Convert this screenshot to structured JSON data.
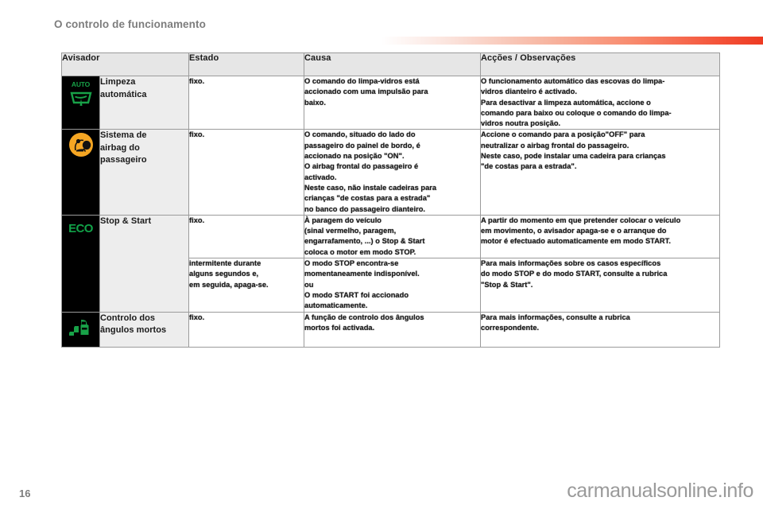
{
  "header": {
    "title": "O controlo de funcionamento",
    "rule_gradient_from": "#ffffff",
    "rule_gradient_to": "#ed3a22"
  },
  "table": {
    "columns": [
      "Avisador",
      "Estado",
      "Causa",
      "Acções / Observações"
    ],
    "rows": [
      {
        "icon": "auto-wiper-icon",
        "icon_label": "AUTO",
        "icon_color": "#18a148",
        "name": "Limpeza\nautomática",
        "state": "fixo.",
        "cause": "O comando do limpa-vidros está\naccionado com uma impulsão para\nbaixo.",
        "actions": "O funcionamento automático das escovas do limpa-\nvidros dianteiro é activado.\nPara desactivar a limpeza automática, accione o\ncomando para baixo ou coloque o comando do limpa-\nvidros noutra posição."
      },
      {
        "icon": "passenger-airbag-icon",
        "icon_label": "",
        "icon_color": "#f5a623",
        "name": "Sistema de\nairbag do\npassageiro",
        "state": "fixo.",
        "cause": "O comando, situado do lado do\npassageiro do painel de bordo, é\naccionado na posição \"ON\".\nO airbag frontal do passageiro é\nactivado.\nNeste caso, não instale cadeiras para\ncrianças \"de costas para a estrada\"\nno banco do passageiro dianteiro.",
        "actions": "Accione o comando para a posição\"OFF\" para\nneutralizar o airbag frontal do passageiro.\nNeste caso, pode instalar uma cadeira para crianças\n\"de costas para a estrada\"."
      },
      {
        "icon": "eco-stop-start-icon",
        "icon_label": "ECO",
        "icon_color": "#11a248",
        "name": "Stop & Start",
        "state": "fixo.",
        "cause": "À paragem do veículo\n(sinal vermelho, paragem,\nengarrafamento, ...) o Stop & Start\ncoloca o motor em modo STOP.",
        "actions": "A partir do momento em que pretender colocar o veículo\nem movimento, o avisador apaga-se e o arranque do\nmotor é efectuado automaticamente em modo START."
      },
      {
        "icon": "",
        "icon_label": "",
        "icon_color": "",
        "name": "",
        "state": "intermitente durante\nalguns segundos e,\nem seguida, apaga-se.",
        "cause": "O modo STOP encontra-se\nmomentaneamente indisponível.\nou\nO modo START foi accionado\nautomaticamente.",
        "actions": "Para mais informações sobre os casos específicos\ndo modo STOP e do modo START, consulte a rubrica\n\"Stop & Start\"."
      },
      {
        "icon": "blind-spot-icon",
        "icon_label": "",
        "icon_color": "#18a148",
        "name": "Controlo dos\nângulos mortos",
        "state": "fixo.",
        "cause": "A função de controlo dos ângulos\nmortos foi activada.",
        "actions": "Para mais informações, consulte a rubrica\ncorrespondente."
      }
    ]
  },
  "footer": {
    "page_number": "16",
    "watermark": "carmanualsonline.info"
  }
}
